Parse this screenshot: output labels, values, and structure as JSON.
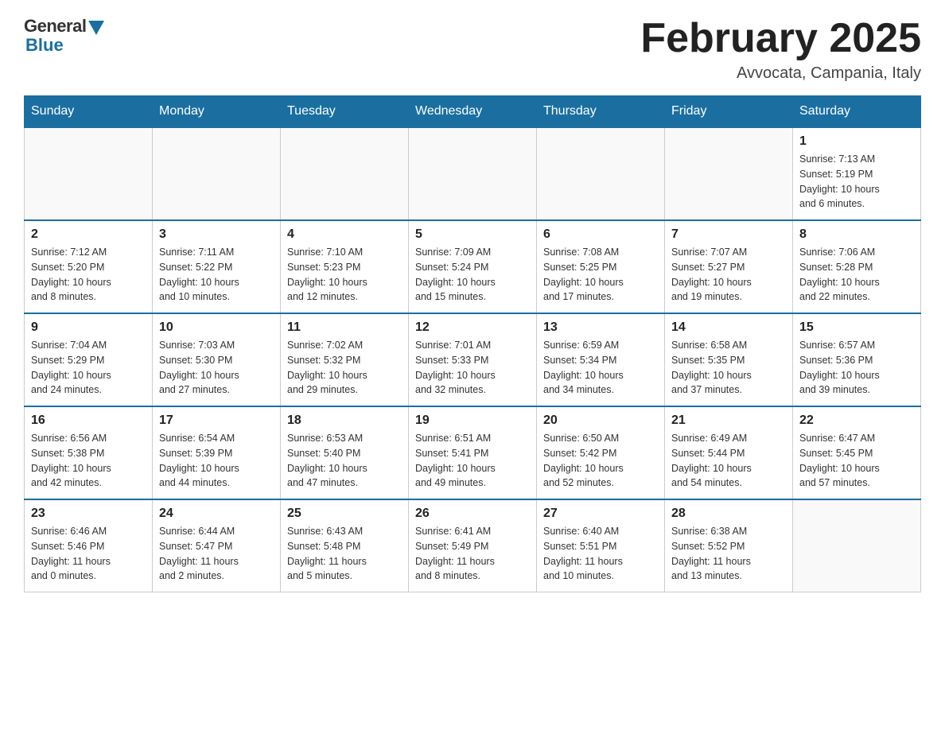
{
  "header": {
    "logo_general": "General",
    "logo_blue": "Blue",
    "title": "February 2025",
    "subtitle": "Avvocata, Campania, Italy"
  },
  "weekdays": [
    "Sunday",
    "Monday",
    "Tuesday",
    "Wednesday",
    "Thursday",
    "Friday",
    "Saturday"
  ],
  "weeks": [
    [
      {
        "day": "",
        "info": ""
      },
      {
        "day": "",
        "info": ""
      },
      {
        "day": "",
        "info": ""
      },
      {
        "day": "",
        "info": ""
      },
      {
        "day": "",
        "info": ""
      },
      {
        "day": "",
        "info": ""
      },
      {
        "day": "1",
        "info": "Sunrise: 7:13 AM\nSunset: 5:19 PM\nDaylight: 10 hours\nand 6 minutes."
      }
    ],
    [
      {
        "day": "2",
        "info": "Sunrise: 7:12 AM\nSunset: 5:20 PM\nDaylight: 10 hours\nand 8 minutes."
      },
      {
        "day": "3",
        "info": "Sunrise: 7:11 AM\nSunset: 5:22 PM\nDaylight: 10 hours\nand 10 minutes."
      },
      {
        "day": "4",
        "info": "Sunrise: 7:10 AM\nSunset: 5:23 PM\nDaylight: 10 hours\nand 12 minutes."
      },
      {
        "day": "5",
        "info": "Sunrise: 7:09 AM\nSunset: 5:24 PM\nDaylight: 10 hours\nand 15 minutes."
      },
      {
        "day": "6",
        "info": "Sunrise: 7:08 AM\nSunset: 5:25 PM\nDaylight: 10 hours\nand 17 minutes."
      },
      {
        "day": "7",
        "info": "Sunrise: 7:07 AM\nSunset: 5:27 PM\nDaylight: 10 hours\nand 19 minutes."
      },
      {
        "day": "8",
        "info": "Sunrise: 7:06 AM\nSunset: 5:28 PM\nDaylight: 10 hours\nand 22 minutes."
      }
    ],
    [
      {
        "day": "9",
        "info": "Sunrise: 7:04 AM\nSunset: 5:29 PM\nDaylight: 10 hours\nand 24 minutes."
      },
      {
        "day": "10",
        "info": "Sunrise: 7:03 AM\nSunset: 5:30 PM\nDaylight: 10 hours\nand 27 minutes."
      },
      {
        "day": "11",
        "info": "Sunrise: 7:02 AM\nSunset: 5:32 PM\nDaylight: 10 hours\nand 29 minutes."
      },
      {
        "day": "12",
        "info": "Sunrise: 7:01 AM\nSunset: 5:33 PM\nDaylight: 10 hours\nand 32 minutes."
      },
      {
        "day": "13",
        "info": "Sunrise: 6:59 AM\nSunset: 5:34 PM\nDaylight: 10 hours\nand 34 minutes."
      },
      {
        "day": "14",
        "info": "Sunrise: 6:58 AM\nSunset: 5:35 PM\nDaylight: 10 hours\nand 37 minutes."
      },
      {
        "day": "15",
        "info": "Sunrise: 6:57 AM\nSunset: 5:36 PM\nDaylight: 10 hours\nand 39 minutes."
      }
    ],
    [
      {
        "day": "16",
        "info": "Sunrise: 6:56 AM\nSunset: 5:38 PM\nDaylight: 10 hours\nand 42 minutes."
      },
      {
        "day": "17",
        "info": "Sunrise: 6:54 AM\nSunset: 5:39 PM\nDaylight: 10 hours\nand 44 minutes."
      },
      {
        "day": "18",
        "info": "Sunrise: 6:53 AM\nSunset: 5:40 PM\nDaylight: 10 hours\nand 47 minutes."
      },
      {
        "day": "19",
        "info": "Sunrise: 6:51 AM\nSunset: 5:41 PM\nDaylight: 10 hours\nand 49 minutes."
      },
      {
        "day": "20",
        "info": "Sunrise: 6:50 AM\nSunset: 5:42 PM\nDaylight: 10 hours\nand 52 minutes."
      },
      {
        "day": "21",
        "info": "Sunrise: 6:49 AM\nSunset: 5:44 PM\nDaylight: 10 hours\nand 54 minutes."
      },
      {
        "day": "22",
        "info": "Sunrise: 6:47 AM\nSunset: 5:45 PM\nDaylight: 10 hours\nand 57 minutes."
      }
    ],
    [
      {
        "day": "23",
        "info": "Sunrise: 6:46 AM\nSunset: 5:46 PM\nDaylight: 11 hours\nand 0 minutes."
      },
      {
        "day": "24",
        "info": "Sunrise: 6:44 AM\nSunset: 5:47 PM\nDaylight: 11 hours\nand 2 minutes."
      },
      {
        "day": "25",
        "info": "Sunrise: 6:43 AM\nSunset: 5:48 PM\nDaylight: 11 hours\nand 5 minutes."
      },
      {
        "day": "26",
        "info": "Sunrise: 6:41 AM\nSunset: 5:49 PM\nDaylight: 11 hours\nand 8 minutes."
      },
      {
        "day": "27",
        "info": "Sunrise: 6:40 AM\nSunset: 5:51 PM\nDaylight: 11 hours\nand 10 minutes."
      },
      {
        "day": "28",
        "info": "Sunrise: 6:38 AM\nSunset: 5:52 PM\nDaylight: 11 hours\nand 13 minutes."
      },
      {
        "day": "",
        "info": ""
      }
    ]
  ]
}
